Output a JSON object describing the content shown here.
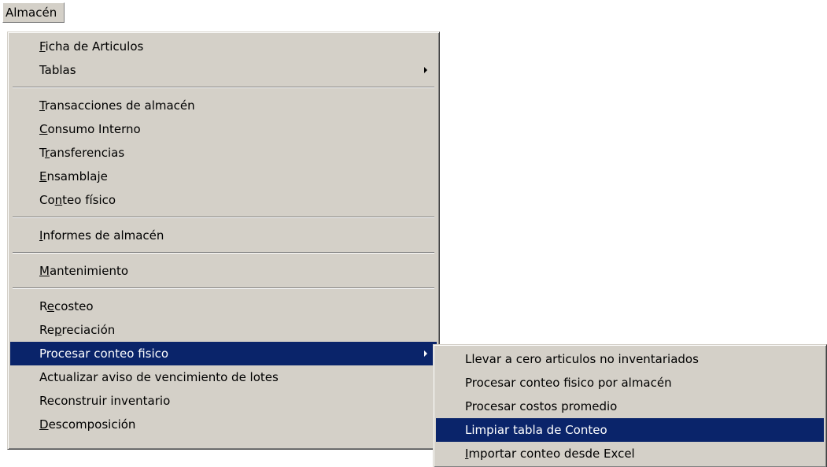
{
  "menubar": {
    "label": "Almacén"
  },
  "main_menu": {
    "items": [
      {
        "pre": "",
        "u": "F",
        "post": "icha de Articulos"
      },
      {
        "pre": "",
        "u": "",
        "post": "Tablas"
      },
      {
        "pre": "",
        "u": "T",
        "post": "ransacciones de almacén"
      },
      {
        "pre": "",
        "u": "C",
        "post": "onsumo Interno"
      },
      {
        "pre": "T",
        "u": "r",
        "post": "ansferencias"
      },
      {
        "pre": "",
        "u": "E",
        "post": "nsamblaje"
      },
      {
        "pre": "Co",
        "u": "n",
        "post": "teo físico"
      },
      {
        "pre": "",
        "u": "I",
        "post": "nformes de almacén"
      },
      {
        "pre": "",
        "u": "M",
        "post": "antenimiento"
      },
      {
        "pre": "R",
        "u": "e",
        "post": "costeo"
      },
      {
        "pre": "Re",
        "u": "p",
        "post": "reciación"
      },
      {
        "pre": "",
        "u": "",
        "post": "Procesar conteo fisico"
      },
      {
        "pre": "",
        "u": "",
        "post": "Actualizar aviso de vencimiento de lotes"
      },
      {
        "pre": "",
        "u": "",
        "post": "Reconstruir inventario"
      },
      {
        "pre": "",
        "u": "D",
        "post": "escomposición"
      }
    ]
  },
  "sub_menu": {
    "items": [
      {
        "pre": "",
        "u": "",
        "post": "Llevar a cero articulos no inventariados"
      },
      {
        "pre": "",
        "u": "",
        "post": "Procesar conteo fisico por almacén"
      },
      {
        "pre": "",
        "u": "",
        "post": "Procesar costos promedio"
      },
      {
        "pre": "",
        "u": "",
        "post": "Limpiar tabla de Conteo"
      },
      {
        "pre": "",
        "u": "I",
        "post": "mportar conteo desde Excel"
      }
    ]
  }
}
